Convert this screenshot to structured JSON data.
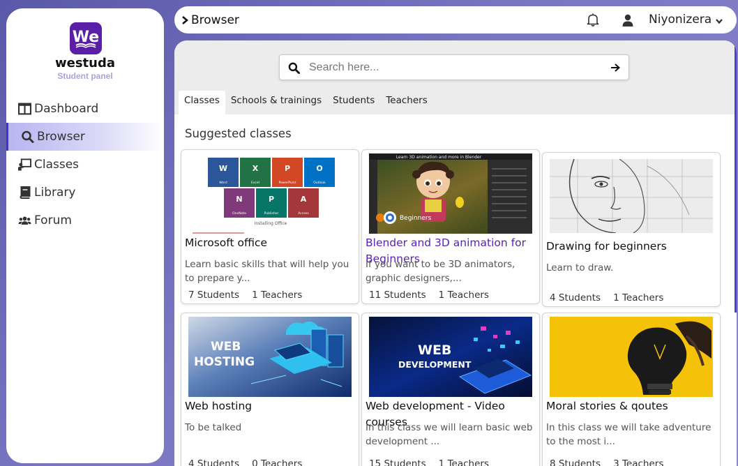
{
  "brand": {
    "name": "westuda",
    "subtitle": "Student panel",
    "logo_text": "We"
  },
  "sidebar": {
    "items": [
      {
        "label": "Dashboard",
        "icon": "columns-icon",
        "active": false
      },
      {
        "label": "Browser",
        "icon": "search-icon",
        "active": true
      },
      {
        "label": "Classes",
        "icon": "chalkboard-teacher-icon",
        "active": false
      },
      {
        "label": "Library",
        "icon": "book-icon",
        "active": false
      },
      {
        "label": "Forum",
        "icon": "users-icon",
        "active": false
      }
    ]
  },
  "topbar": {
    "title": "Browser",
    "user_name": "Niyonizera"
  },
  "search": {
    "placeholder": "Search here..."
  },
  "tabs": [
    {
      "label": "Classes",
      "active": true
    },
    {
      "label": "Schools & trainings",
      "active": false
    },
    {
      "label": "Students",
      "active": false
    },
    {
      "label": "Teachers",
      "active": false
    }
  ],
  "section_title": "Suggested classes",
  "classes": [
    {
      "title": "Microsoft office",
      "description": "Learn basic skills that will help you to prepare y...",
      "students": "7",
      "teachers": "1",
      "thumb": "ms-office",
      "thumb_caption": "Installing Office",
      "thumb_tiles": [
        "Word",
        "Excel",
        "PowerPoint",
        "Outlook",
        "OneNote",
        "Publisher",
        "Access"
      ]
    },
    {
      "title": "Blender and 3D animation for Beginners",
      "description": "If you want to be 3D animators, graphic designers,...",
      "students": "11",
      "teachers": "1",
      "thumb": "blender",
      "thumb_caption": "Learn 3D animation and more in Blender",
      "thumb_badge": "Beginners"
    },
    {
      "title": "Drawing for beginners",
      "description": "Learn to draw.",
      "students": "4",
      "teachers": "1",
      "thumb": "drawing"
    },
    {
      "title": "Web hosting",
      "description": "To be talked",
      "students": "4",
      "teachers": "0",
      "thumb": "web-hosting",
      "thumb_text": [
        "WEB",
        "HOSTING"
      ]
    },
    {
      "title": "Web development - Video courses",
      "description": "In this class we will learn basic web development ...",
      "students": "15",
      "teachers": "1",
      "thumb": "web-dev",
      "thumb_text": [
        "WEB",
        "DEVELOPMENT"
      ]
    },
    {
      "title": "Moral stories & qoutes",
      "description": "In this class we will take adventure to the most i...",
      "students": "8",
      "teachers": "3",
      "thumb": "bulb"
    }
  ],
  "labels": {
    "students": "Students",
    "teachers": "Teachers"
  },
  "colors": {
    "accent": "#3d35d6",
    "brand_purple": "#5b1ea8",
    "highlight_title": "#5a22b8"
  }
}
